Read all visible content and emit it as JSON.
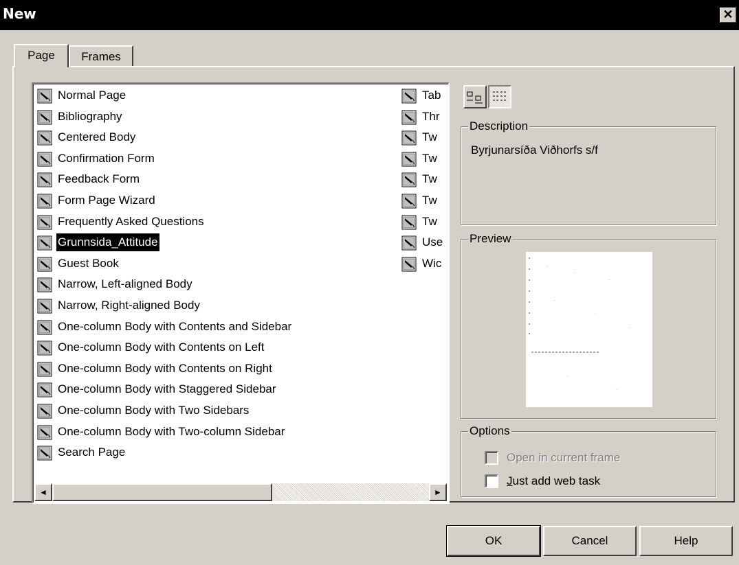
{
  "window": {
    "title": "New",
    "close_glyph": "✕"
  },
  "tabs": [
    {
      "label": "Page",
      "active": true
    },
    {
      "label": "Frames",
      "active": false
    }
  ],
  "templates_col1": [
    "Normal Page",
    "Bibliography",
    "Centered Body",
    "Confirmation Form",
    "Feedback Form",
    "Form Page Wizard",
    "Frequently Asked Questions",
    "Grunnsida_Attitude",
    "Guest Book",
    "Narrow, Left-aligned Body",
    "Narrow, Right-aligned Body",
    "One-column Body with Contents and Sidebar",
    "One-column Body with Contents on Left",
    "One-column Body with Contents on Right",
    "One-column Body with Staggered Sidebar",
    "One-column Body with Two Sidebars",
    "One-column Body with Two-column Sidebar",
    "Search Page"
  ],
  "templates_col2": [
    "Tab",
    "Thr",
    "Tw",
    "Tw",
    "Tw",
    "Tw",
    "Tw",
    "Use",
    "Wic"
  ],
  "selected_item": "Grunnsida_Attitude",
  "description": {
    "label": "Description",
    "text": "Byrjunarsíða Viðhorfs s/f"
  },
  "preview": {
    "label": "Preview"
  },
  "options": {
    "label": "Options",
    "open_in_current_frame": {
      "label": "Open in current frame",
      "checked": false,
      "disabled": true
    },
    "just_add_web_task": {
      "label": "Just add web task",
      "checked": false,
      "disabled": false
    }
  },
  "buttons": {
    "ok": "OK",
    "cancel": "Cancel",
    "help": "Help"
  },
  "icons": {
    "scroll_left": "◄",
    "scroll_right": "►"
  }
}
